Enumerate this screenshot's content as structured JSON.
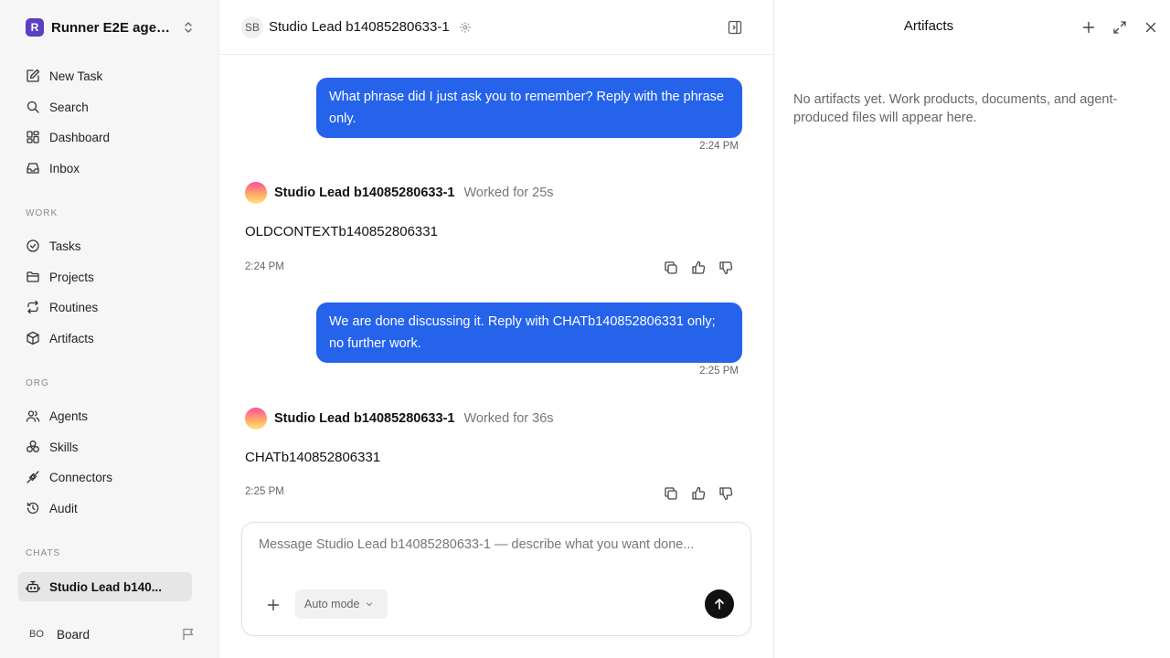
{
  "sidebar": {
    "workspace": {
      "logo_letter": "R",
      "name": "Runner E2E agen..."
    },
    "nav_main": [
      {
        "label": "New Task",
        "icon": "new-task-icon"
      },
      {
        "label": "Search",
        "icon": "search-icon"
      },
      {
        "label": "Dashboard",
        "icon": "dashboard-icon"
      },
      {
        "label": "Inbox",
        "icon": "inbox-icon"
      }
    ],
    "section_work": "WORK",
    "nav_work": [
      {
        "label": "Tasks",
        "icon": "check-circle-icon"
      },
      {
        "label": "Projects",
        "icon": "folder-icon"
      },
      {
        "label": "Routines",
        "icon": "repeat-icon"
      },
      {
        "label": "Artifacts",
        "icon": "box-icon"
      }
    ],
    "section_org": "ORG",
    "nav_org": [
      {
        "label": "Agents",
        "icon": "users-icon"
      },
      {
        "label": "Skills",
        "icon": "skills-icon"
      },
      {
        "label": "Connectors",
        "icon": "plug-icon"
      },
      {
        "label": "Audit",
        "icon": "history-icon"
      }
    ],
    "section_chats": "CHATS",
    "chats": [
      {
        "label": "Studio Lead b140...",
        "icon": "bot-icon",
        "active": true
      }
    ],
    "user": {
      "initials": "BO",
      "name": "Board"
    }
  },
  "chat": {
    "header": {
      "avatar_initials": "SB",
      "title": "Studio Lead b14085280633-1"
    },
    "messages": [
      {
        "role": "user",
        "text": "What phrase did I just ask you to remember? Reply with the phrase only.",
        "time": "2:24 PM"
      },
      {
        "role": "agent",
        "name": "Studio Lead b14085280633-1",
        "worked": "Worked for 25s",
        "text": "OLDCONTEXTb140852806331",
        "time": "2:24 PM"
      },
      {
        "role": "user",
        "text": "We are done discussing it. Reply with CHATb140852806331 only; no further work.",
        "time": "2:25 PM"
      },
      {
        "role": "agent",
        "name": "Studio Lead b14085280633-1",
        "worked": "Worked for 36s",
        "text": "CHATb140852806331",
        "time": "2:25 PM"
      }
    ],
    "composer": {
      "placeholder": "Message Studio Lead b14085280633-1 — describe what you want done...",
      "value": "",
      "mode_label": "Auto mode"
    }
  },
  "artifacts_panel": {
    "title": "Artifacts",
    "empty_text": "No artifacts yet. Work products, documents, and agent-produced files will appear here."
  },
  "colors": {
    "accent": "#2563eb",
    "sidebar_bg": "#f6f6f6",
    "send_button": "#111111"
  }
}
